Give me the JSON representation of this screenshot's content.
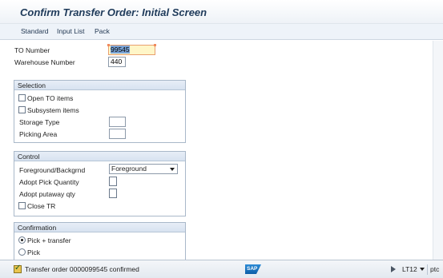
{
  "window": {
    "title": "Confirm Transfer Order: Initial Screen"
  },
  "toolbar": {
    "standard": "Standard",
    "input_list": "Input List",
    "pack": "Pack"
  },
  "header_fields": {
    "to_number_label": "TO Number",
    "to_number_value": "99545",
    "warehouse_label": "Warehouse Number",
    "warehouse_value": "440"
  },
  "selection": {
    "title": "Selection",
    "open_to_items": "Open TO items",
    "subsystem_items": "Subsystem items",
    "storage_type_label": "Storage Type",
    "storage_type_value": "",
    "picking_area_label": "Picking Area",
    "picking_area_value": ""
  },
  "control": {
    "title": "Control",
    "fg_bg_label": "Foreground/Backgrnd",
    "fg_bg_value": "Foreground",
    "adopt_pick_label": "Adopt Pick Quantity",
    "adopt_putaway_label": "Adopt putaway qty",
    "close_tr_label": "Close TR"
  },
  "confirmation": {
    "title": "Confirmation",
    "pick_transfer": "Pick + transfer",
    "pick": "Pick"
  },
  "status_bar": {
    "message": "Transfer order 0000099545 confirmed",
    "logo": "SAP",
    "tcode": "LT12",
    "host": "ptc"
  }
}
